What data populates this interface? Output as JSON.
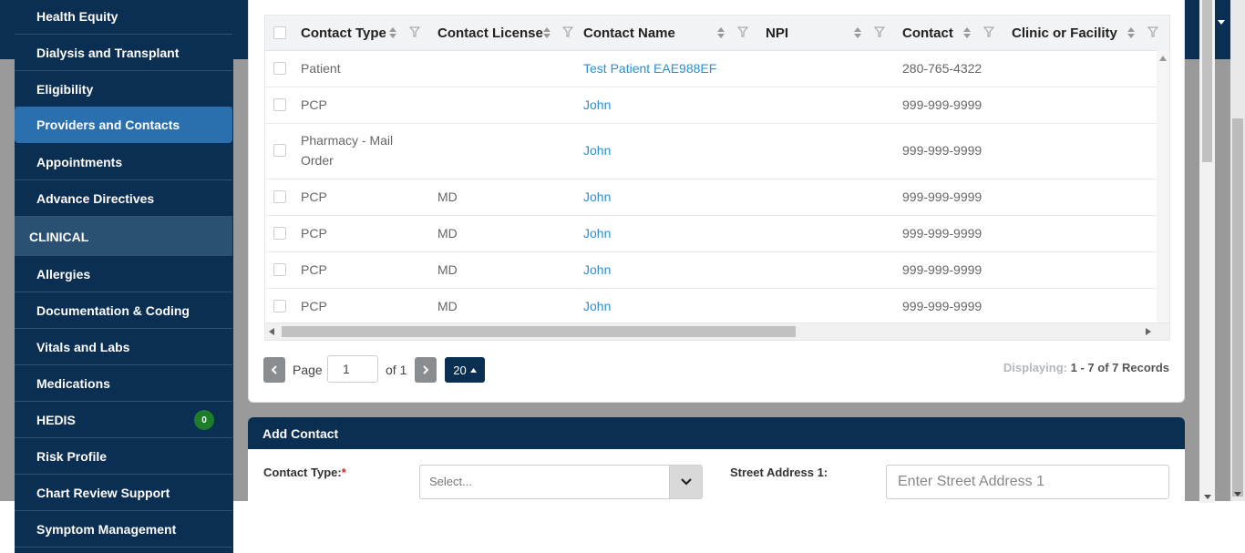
{
  "sidebar": {
    "items": [
      {
        "label": "Health Equity"
      },
      {
        "label": "Dialysis and Transplant"
      },
      {
        "label": "Eligibility"
      },
      {
        "label": "Providers and Contacts"
      },
      {
        "label": "Appointments"
      },
      {
        "label": "Advance Directives"
      }
    ],
    "section_clinical": "CLINICAL",
    "clinical_items": [
      {
        "label": "Allergies"
      },
      {
        "label": "Documentation & Coding"
      },
      {
        "label": "Vitals and Labs"
      },
      {
        "label": "Medications"
      },
      {
        "label": "HEDIS",
        "badge": "0"
      },
      {
        "label": "Risk Profile"
      },
      {
        "label": "Chart Review Support"
      },
      {
        "label": "Symptom Management"
      }
    ],
    "active_item": "Providers and Contacts",
    "badge_color": "#1e7d2a"
  },
  "grid": {
    "columns": [
      "Contact Type",
      "Contact License",
      "Contact Name",
      "NPI",
      "Contact",
      "Clinic or Facility"
    ],
    "rows": [
      {
        "type": "Patient",
        "license": "",
        "name": "Test Patient EAE988EF",
        "npi": "",
        "contact": "280-765-4322"
      },
      {
        "type": "PCP",
        "license": "",
        "name": "John",
        "npi": "",
        "contact": "999-999-9999"
      },
      {
        "type": "Pharmacy - Mail",
        "type2": "Order",
        "license": "",
        "name": "John",
        "npi": "",
        "contact": "999-999-9999"
      },
      {
        "type": "PCP",
        "license": "MD",
        "name": "John",
        "npi": "",
        "contact": "999-999-9999"
      },
      {
        "type": "PCP",
        "license": "MD",
        "name": "John",
        "npi": "",
        "contact": "999-999-9999"
      },
      {
        "type": "PCP",
        "license": "MD",
        "name": "John",
        "npi": "",
        "contact": "999-999-9999"
      },
      {
        "type": "PCP",
        "license": "MD",
        "name": "John",
        "npi": "",
        "contact": "999-999-9999"
      }
    ],
    "link_color": "#2b8fd0"
  },
  "pager": {
    "page_label": "Page",
    "page_value": "1",
    "of_label": "of 1",
    "page_size": "20",
    "displaying_label": "Displaying:",
    "records": "1 - 7 of 7 Records"
  },
  "add_contact": {
    "title": "Add Contact",
    "contact_type_label": "Contact Type:",
    "required_mark": "*",
    "select_placeholder": "Select...",
    "street_label": "Street Address 1:",
    "street_placeholder": "Enter Street Address 1"
  },
  "colors": {
    "navy": "#0b2f52",
    "active": "#2a6fae"
  }
}
